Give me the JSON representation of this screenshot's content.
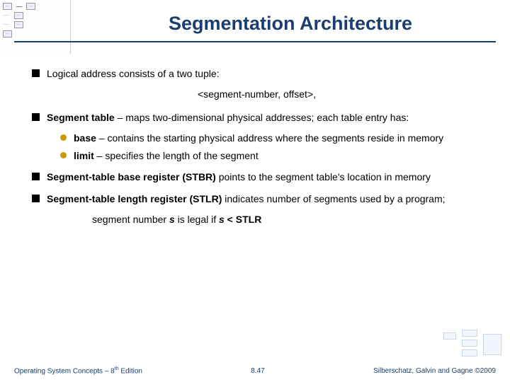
{
  "title": "Segmentation Architecture",
  "bullets": {
    "b1_text": "Logical address consists of a two tuple:",
    "b1_sub": "<segment-number, offset>,",
    "b2_lead": "Segment table",
    "b2_rest": " – maps two-dimensional physical addresses; each table entry has:",
    "b2_sub1_lead": "base",
    "b2_sub1_rest": " – contains the starting physical address where the segments reside in memory",
    "b2_sub2_lead": "limit",
    "b2_sub2_rest": " – specifies the length of the segment",
    "b3_lead": "Segment-table base register (STBR)",
    "b3_rest": " points to the segment table's location in memory",
    "b4_lead": "Segment-table length register (STLR)",
    "b4_rest": " indicates number of segments used by a program;",
    "b4_sub_pre": "segment number ",
    "b4_sub_s1": "s",
    "b4_sub_mid": " is legal if ",
    "b4_sub_s2": "s",
    "b4_sub_cmp": " < ",
    "b4_sub_stlr": "STLR"
  },
  "footer": {
    "left_pre": "Operating System Concepts – 8",
    "left_sup": "th",
    "left_post": " Edition",
    "center": "8.47",
    "right": "Silberschatz, Galvin and Gagne ©2009"
  }
}
